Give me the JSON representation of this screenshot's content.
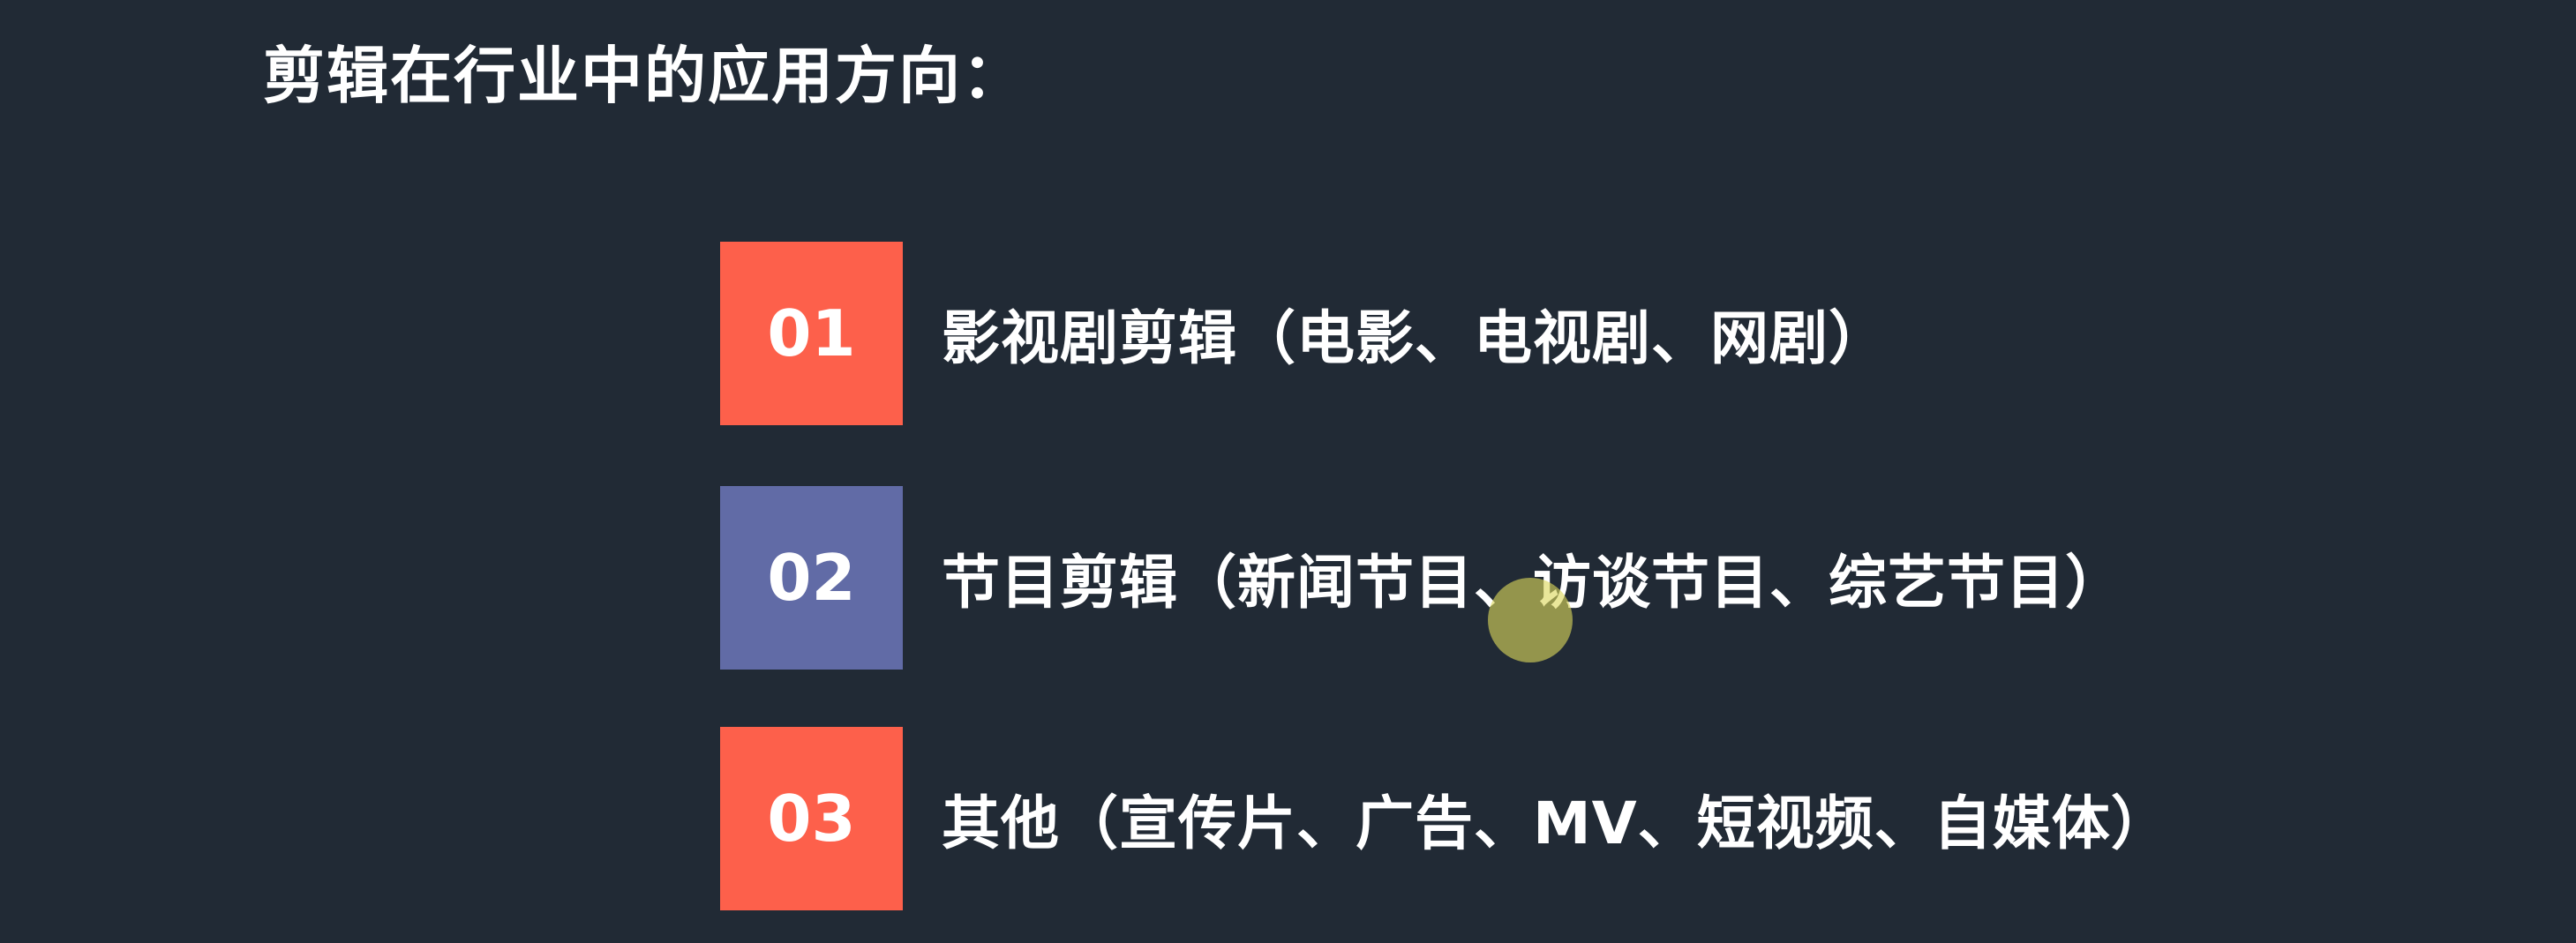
{
  "slide": {
    "title": "剪辑在行业中的应用方向：",
    "items": [
      {
        "number": "01",
        "text": "影视剧剪辑（电影、电视剧、网剧）",
        "color": "#fd604b"
      },
      {
        "number": "02",
        "text": "节目剪辑（新闻节目、访谈节目、综艺节目）",
        "color": "#616ba6"
      },
      {
        "number": "03",
        "text": "其他（宣传片、广告、MV、短视频、自媒体）",
        "color": "#fd604b"
      }
    ]
  },
  "colors": {
    "background": "#212a35",
    "text": "#ffffff",
    "cursor_highlight": "#dcd75a"
  }
}
